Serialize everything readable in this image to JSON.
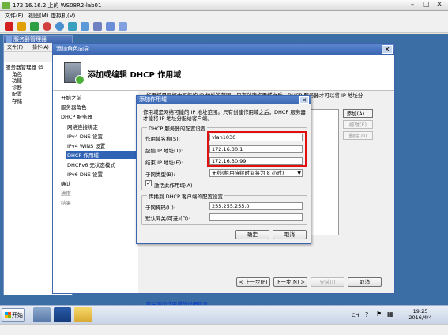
{
  "vm": {
    "title": "172.16.16.2 上的 WS08R2-lab01",
    "menu": [
      "文件(F)",
      "视图(M)",
      "虚拟机(V)"
    ],
    "minimize": "–",
    "maximize": "□",
    "close": "✕"
  },
  "server_manager": {
    "title": "服务器管理器",
    "menu": [
      "文件(F)",
      "操作(A)"
    ],
    "tree": [
      "服务器管理器 (S",
      "角色",
      "功能",
      "诊断",
      "配置",
      "存储"
    ]
  },
  "wizard": {
    "title": "添加角色向导",
    "close": "✕",
    "heading": "添加或编辑 DHCP 作用域",
    "nav": [
      {
        "label": "开始之前",
        "state": "normal"
      },
      {
        "label": "服务器角色",
        "state": "normal"
      },
      {
        "label": "DHCP 服务器",
        "state": "normal"
      },
      {
        "label": "网络连接绑定",
        "state": "normal"
      },
      {
        "label": "IPv4 DNS 设置",
        "state": "normal"
      },
      {
        "label": "IPv4 WINS 设置",
        "state": "normal"
      },
      {
        "label": "DHCP 作用域",
        "state": "selected"
      },
      {
        "label": "DHCPv6 无状态模式",
        "state": "normal"
      },
      {
        "label": "IPv6 DNS 设置",
        "state": "normal"
      },
      {
        "label": "确认",
        "state": "normal"
      },
      {
        "label": "进度",
        "state": "dim"
      },
      {
        "label": "结果",
        "state": "dim"
      }
    ],
    "description": "作用域是网络中可能的 IP 地址的范围。只有创建作用域之后，DHCP 服务器才可以将 IP 地址分",
    "buttons_right": {
      "add": "添加(A)...",
      "edit": "编辑(E)",
      "delete": "删除(D)"
    },
    "help_link": "有关添加作用域的详细信息",
    "buttons_bottom": {
      "prev": "< 上一步(P)",
      "next": "下一步(N) >",
      "install": "安装(I)",
      "cancel": "取消"
    }
  },
  "dialog": {
    "title": "添加作用域",
    "close": "✕",
    "intro": "作用域是网络可能的 IP 地址范围。只有创建作用域之后，DHCP 服务器才能将 IP 地址分配给客户端。",
    "group1": "DHCP 服务器的配置设置",
    "scope_name_label": "作用域名称(S):",
    "scope_name_value": "vlan1030",
    "start_ip_label": "起始 IP 地址(T):",
    "start_ip_value": "172.16.30.1",
    "end_ip_label": "结束 IP 地址(E):",
    "end_ip_value": "172.16.30.99",
    "subnet_type_label": "子网类型(B):",
    "subnet_type_value": "无线(租用持续时间将为 8 小时)",
    "activate_label": "激活此作用域(A)",
    "activate_checked": "✓",
    "group2": "传播到 DHCP 客户端的配置设置",
    "subnet_mask_label": "子网掩码(U):",
    "subnet_mask_value": "255.255.255.0",
    "gateway_label": "默认网关(可选)(D):",
    "gateway_value": "",
    "ok": "确定",
    "cancel": "取消"
  },
  "taskbar": {
    "start": "开始",
    "lang": "CH",
    "time": "19:25",
    "date": "2016/4/4"
  }
}
